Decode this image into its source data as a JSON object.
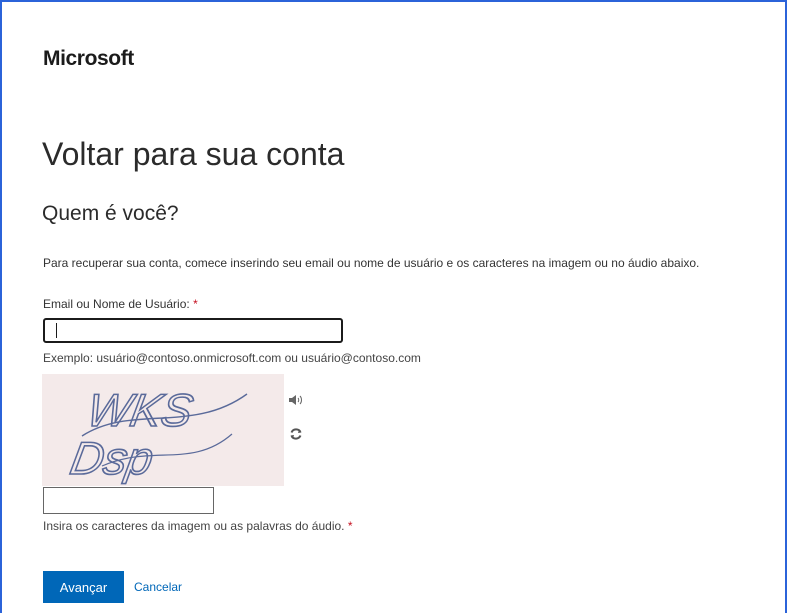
{
  "brand": {
    "logo_text": "Microsoft"
  },
  "page": {
    "title": "Voltar para sua conta",
    "subtitle": "Quem é você?",
    "instructions": "Para recuperar sua conta, comece inserindo seu email ou nome de usuário e os caracteres na imagem ou no áudio abaixo."
  },
  "email_field": {
    "label": "Email ou Nome de Usuário:",
    "required_mark": "*",
    "value": "",
    "example": "Exemplo: usuário@contoso.onmicrosoft.com ou usuário@contoso.com"
  },
  "captcha": {
    "image_text": "WKS Dsp",
    "line1": "WKS",
    "line2": "Dsp",
    "audio_icon": "speaker-icon",
    "refresh_icon": "refresh-icon",
    "input_value": "",
    "label": "Insira os caracteres da imagem ou as palavras do áudio.",
    "required_mark": "*"
  },
  "actions": {
    "next_label": "Avançar",
    "cancel_label": "Cancelar"
  },
  "colors": {
    "accent": "#0067b8",
    "frame_border": "#2b63d9",
    "required": "#c50f1f",
    "captcha_bg": "#f4eaea"
  }
}
